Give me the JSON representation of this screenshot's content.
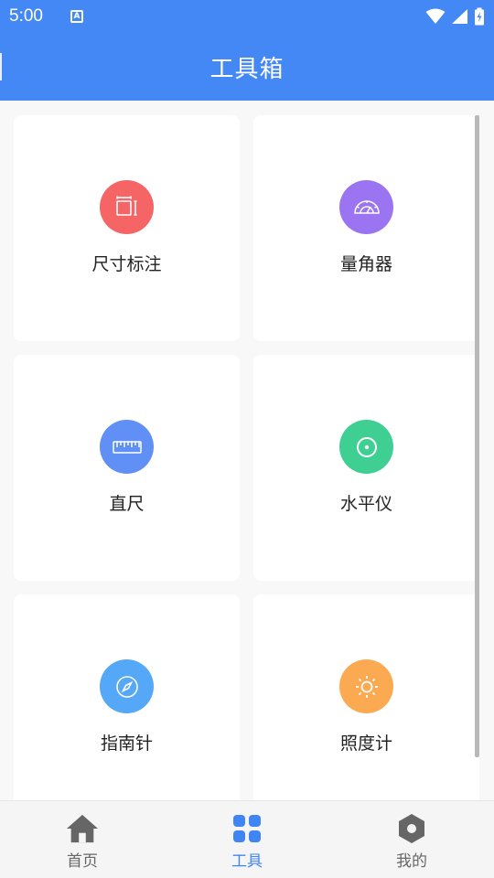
{
  "status_bar": {
    "time": "5:00",
    "notification_letter": "A"
  },
  "app_bar": {
    "title": "工具箱"
  },
  "tools": [
    {
      "label": "尺寸标注",
      "color": "#f56565",
      "icon": "dimension-icon"
    },
    {
      "label": "量角器",
      "color": "#9b74f2",
      "icon": "protractor-icon"
    },
    {
      "label": "直尺",
      "color": "#6090f5",
      "icon": "ruler-icon"
    },
    {
      "label": "水平仪",
      "color": "#3fcf92",
      "icon": "level-icon"
    },
    {
      "label": "指南针",
      "color": "#55a7f7",
      "icon": "compass-icon"
    },
    {
      "label": "照度计",
      "color": "#fbaa52",
      "icon": "light-meter-icon"
    }
  ],
  "bottom_nav": {
    "items": [
      {
        "label": "首页",
        "icon": "home-icon",
        "active": false
      },
      {
        "label": "工具",
        "icon": "grid-icon",
        "active": true
      },
      {
        "label": "我的",
        "icon": "hexagon-icon",
        "active": false
      }
    ],
    "active_color": "#3f86f4",
    "inactive_color": "#666666"
  }
}
